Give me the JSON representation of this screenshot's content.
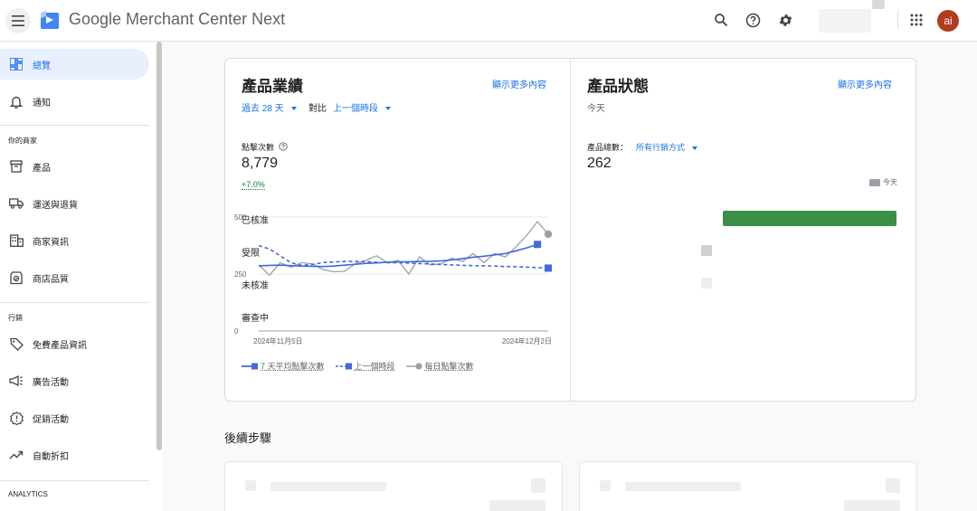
{
  "app": {
    "title": "Google Merchant Center Next",
    "avatar_initials": "ai"
  },
  "sidebar": {
    "items": [
      {
        "label": "總覽",
        "icon": "dashboard-icon",
        "active": true
      },
      {
        "label": "通知",
        "icon": "bell-icon"
      }
    ],
    "sections": [
      {
        "label": "你的商家",
        "items": [
          {
            "label": "產品",
            "icon": "archive-box-icon"
          },
          {
            "label": "運送與退貨",
            "icon": "truck-icon"
          },
          {
            "label": "商家資訊",
            "icon": "building-icon"
          },
          {
            "label": "商店品質",
            "icon": "store-quality-icon"
          }
        ]
      },
      {
        "label": "行銷",
        "items": [
          {
            "label": "免費產品資訊",
            "icon": "tag-icon"
          },
          {
            "label": "廣告活動",
            "icon": "megaphone-icon"
          },
          {
            "label": "促銷活動",
            "icon": "promotion-icon"
          },
          {
            "label": "自動折扣",
            "icon": "trending-icon"
          }
        ]
      },
      {
        "label": "ANALYTICS",
        "items": []
      }
    ]
  },
  "performance": {
    "title": "產品業績",
    "show_more": "顯示更多內容",
    "range_label": "過去 28 天",
    "compare_prefix": "對比",
    "compare_label": "上一個時段",
    "metric_label": "點擊次數",
    "metric_value": "8,779",
    "metric_delta": "+7.0%",
    "legend": [
      "7 天平均點擊次數",
      "上一個時段",
      "每日點擊次數"
    ]
  },
  "status": {
    "title": "產品狀態",
    "subtitle": "今天",
    "total_label": "產品總數：",
    "channel_label": "所有行銷方式",
    "total_value": "262",
    "legend_today": "今天",
    "rows": [
      {
        "label": "已核准",
        "fraction": 0.98
      },
      {
        "label": "受限",
        "fraction": 0.0
      },
      {
        "label": "未核准",
        "fraction": 0.0
      },
      {
        "label": "審查中",
        "fraction": 0.0
      }
    ]
  },
  "next_steps": {
    "title": "後續步驟"
  },
  "colors": {
    "accent": "#1a73e8",
    "approved": "#3c8f47",
    "daily": "#9aa0a6",
    "avatar": "#b23b1f"
  },
  "chart_data": {
    "type": "line",
    "x_tick_labels": [
      "2024年11月5日",
      "2024年12月2日"
    ],
    "y_ticks": [
      0,
      250,
      500
    ],
    "ylim": [
      0,
      500
    ],
    "x": [
      1,
      2,
      3,
      4,
      5,
      6,
      7,
      8,
      9,
      10,
      11,
      12,
      13,
      14,
      15,
      16,
      17,
      18,
      19,
      20,
      21,
      22,
      23,
      24,
      25,
      26,
      27,
      28
    ],
    "series": [
      {
        "name": "7 天平均點擊次數",
        "style": "solid",
        "color": "#3f6ad8",
        "values": [
          286,
          288,
          289,
          287,
          285,
          284,
          283,
          285,
          289,
          293,
          297,
          299,
          302,
          303,
          304,
          305,
          306,
          308,
          312,
          318,
          324,
          328,
          334,
          340,
          352,
          365,
          380,
          null
        ]
      },
      {
        "name": "上一個時段",
        "style": "dashed",
        "color": "#3f6ad8",
        "values": [
          375,
          360,
          330,
          300,
          288,
          292,
          300,
          303,
          305,
          305,
          304,
          302,
          300,
          300,
          298,
          296,
          294,
          292,
          290,
          288,
          287,
          286,
          285,
          283,
          282,
          280,
          278,
          276
        ]
      },
      {
        "name": "每日點擊次數",
        "style": "solid",
        "color": "#9aa0a6",
        "values": [
          290,
          245,
          300,
          280,
          300,
          295,
          270,
          260,
          262,
          295,
          310,
          330,
          300,
          310,
          250,
          325,
          290,
          295,
          320,
          305,
          340,
          300,
          340,
          325,
          370,
          420,
          480,
          425
        ]
      }
    ]
  }
}
